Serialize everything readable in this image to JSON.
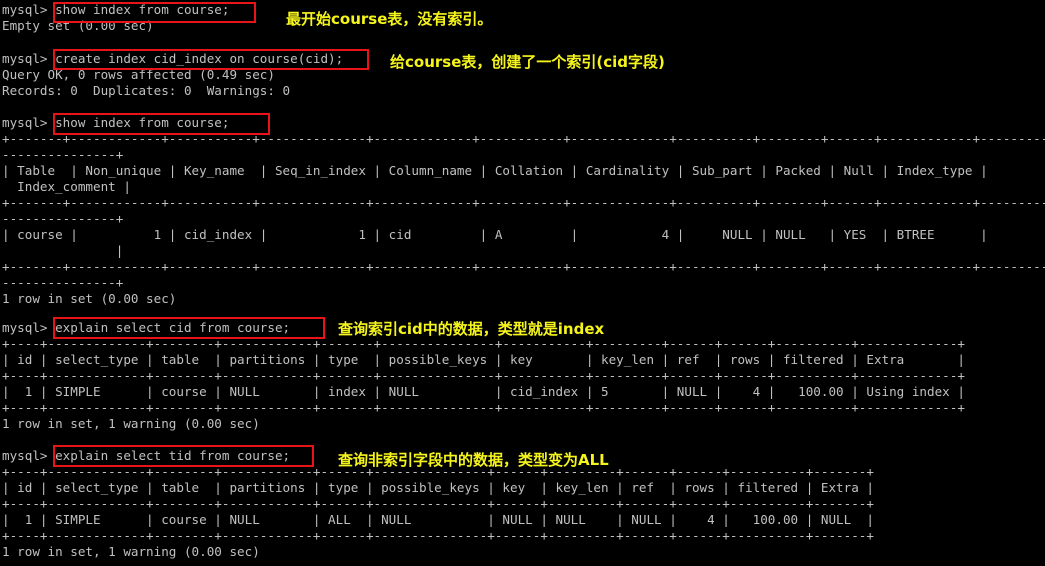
{
  "terminal": {
    "lines": [
      "mysql> show index from course;",
      "Empty set (0.00 sec)",
      "",
      "mysql> create index cid_index on course(cid);",
      "Query OK, 0 rows affected (0.49 sec)",
      "Records: 0  Duplicates: 0  Warnings: 0",
      "",
      "mysql> show index from course;",
      "+-------+------------+-----------+--------------+-------------+-----------+-------------+----------+--------+------+------------+---------+-",
      "---------------+",
      "| Table  | Non_unique | Key_name  | Seq_in_index | Column_name | Collation | Cardinality | Sub_part | Packed | Null | Index_type |",
      "  Index_comment |",
      "+-------+------------+-----------+--------------+-------------+-----------+-------------+----------+--------+------+------------+---------+-",
      "---------------+",
      "| course |          1 | cid_index |            1 | cid         | A         |           4 |     NULL | NULL   | YES  | BTREE      |",
      "               |",
      "+-------+------------+-----------+--------------+-------------+-----------+-------------+----------+--------+------+------------+---------+-",
      "---------------+",
      "1 row in set (0.00 sec)",
      "",
      "mysql> explain select cid from course;",
      "+----+-------------+--------+------------+-------+---------------+-----------+---------+------+------+----------+-------------+",
      "| id | select_type | table  | partitions | type  | possible_keys | key       | key_len | ref  | rows | filtered | Extra       |",
      "+----+-------------+--------+------------+-------+---------------+-----------+---------+------+------+----------+-------------+",
      "|  1 | SIMPLE      | course | NULL       | index | NULL          | cid_index | 5       | NULL |    4 |   100.00 | Using index |",
      "+----+-------------+--------+------------+-------+---------------+-----------+---------+------+------+----------+-------------+",
      "1 row in set, 1 warning (0.00 sec)",
      "",
      "mysql> explain select tid from course;",
      "+----+-------------+--------+------------+------+---------------+------+---------+------+------+----------+-------+",
      "| id | select_type | table  | partitions | type | possible_keys | key  | key_len | ref  | rows | filtered | Extra |",
      "+----+-------------+--------+------------+------+---------------+------+---------+------+------+----------+-------+",
      "|  1 | SIMPLE      | course | NULL       | ALL  | NULL          | NULL | NULL    | NULL |    4 |   100.00 | NULL  |",
      "+----+-------------+--------+------------+------+---------------+------+---------+------+------+----------+-------+",
      "1 row in set, 1 warning (0.00 sec)"
    ]
  },
  "annotations": [
    "最开始course表，没有索引。",
    "给course表，创建了一个索引(cid字段)",
    "查询索引cid中的数据，类型就是index",
    "查询非索引字段中的数据，类型变为ALL"
  ],
  "colors": {
    "background": "#000000",
    "text": "#c0c0c0",
    "highlight_box": "#e8141a",
    "annotation": "#f5f51c"
  }
}
